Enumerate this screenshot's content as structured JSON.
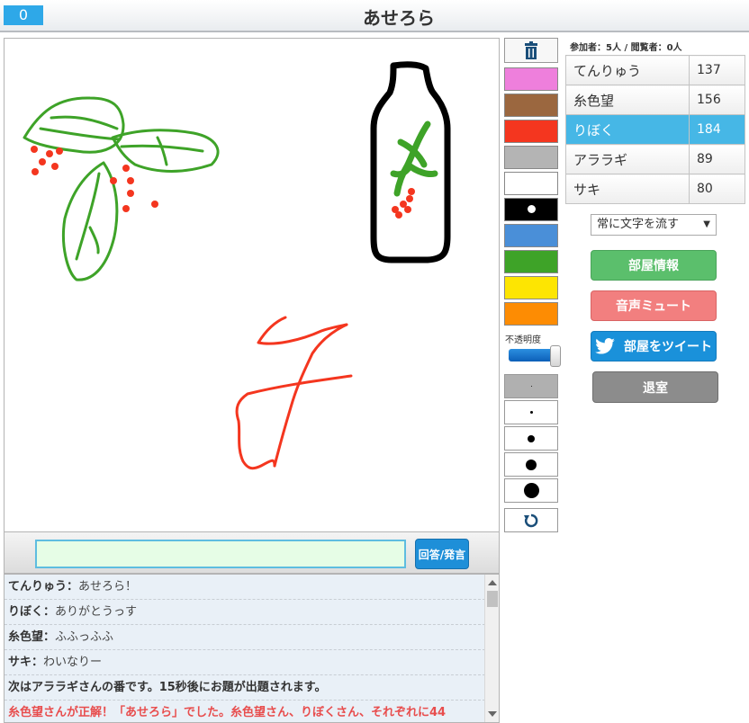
{
  "header": {
    "timer": "0",
    "title": "あせろら"
  },
  "room_counts": "参加者：5人 / 閲覧者：0人",
  "players": [
    {
      "name": "てんりゅう",
      "score": "137",
      "active": false
    },
    {
      "name": "糸色望",
      "score": "156",
      "active": false
    },
    {
      "name": "りぼく",
      "score": "184",
      "active": true
    },
    {
      "name": "アララギ",
      "score": "89",
      "active": false
    },
    {
      "name": "サキ",
      "score": "80",
      "active": false
    }
  ],
  "text_mode_select": "常に文字を流す",
  "buttons": {
    "room_info": "部屋情報",
    "mute": "音声ミュート",
    "tweet": "部屋をツイート",
    "exit": "退室",
    "answer": "回答/発言"
  },
  "palette_colors": [
    "#ee7fdc",
    "#9b673f",
    "#f4361f",
    "#b4b4b4",
    "#ffffff",
    "#000000",
    "#4a8fd8",
    "#3ea328",
    "#fde502",
    "#fd8c03"
  ],
  "opacity_label": "不透明度",
  "brush_sizes": [
    1,
    3,
    8,
    12,
    17
  ],
  "answer_input": {
    "value": "",
    "placeholder": ""
  },
  "chat": [
    {
      "name": "てんりゅう",
      "text": "あせろら！",
      "kind": "user"
    },
    {
      "name": "りぼく",
      "text": "ありがとうっす",
      "kind": "user"
    },
    {
      "name": "糸色望",
      "text": "ふふっふふ",
      "kind": "user"
    },
    {
      "name": "サキ",
      "text": "わいなりー",
      "kind": "user"
    },
    {
      "name": "",
      "text": "次はアララギさんの番です。15秒後にお題が出題されます。",
      "kind": "system"
    },
    {
      "name": "",
      "text": "糸色望さんが正解！「あせろら」でした。糸色望さん、りぼくさん、それぞれに44",
      "kind": "correct"
    }
  ]
}
